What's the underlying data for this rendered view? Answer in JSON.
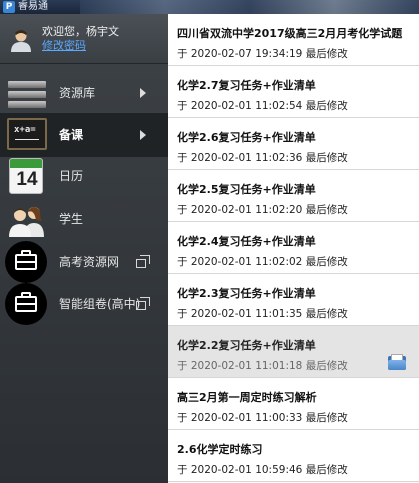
{
  "window": {
    "app_icon": "app-logo-icon",
    "title": "睿易通"
  },
  "user": {
    "avatar_icon": "user-avatar-icon",
    "welcome": "欢迎您，杨宇文",
    "change_password": "修改密码"
  },
  "nav": [
    {
      "label": "资源库",
      "icon": "bookshelf-icon",
      "has_arrow": true,
      "active": false
    },
    {
      "label": "备课",
      "icon": "blackboard-icon",
      "has_arrow": true,
      "active": true
    },
    {
      "label": "日历",
      "icon": "calendar-icon",
      "calendar_day": "14",
      "has_arrow": false,
      "active": false
    },
    {
      "label": "学生",
      "icon": "students-icon",
      "has_arrow": false,
      "active": false
    },
    {
      "label": "高考资源网",
      "icon": "briefcase-icon",
      "external_icon": "open-external-icon",
      "active": false
    },
    {
      "label": "智能组卷(高中)",
      "icon": "briefcase-icon",
      "external_icon": "open-external-icon",
      "active": false
    }
  ],
  "documents": [
    {
      "title": "四川省双流中学2017级高三2月月考化学试题",
      "meta": "于 2020-02-07 19:34:19 最后修改",
      "selected": false
    },
    {
      "title": "化学2.7复习任务+作业清单",
      "meta": "于 2020-02-01 11:02:54 最后修改",
      "selected": false
    },
    {
      "title": "化学2.6复习任务+作业清单",
      "meta": "于 2020-02-01 11:02:36 最后修改",
      "selected": false
    },
    {
      "title": "化学2.5复习任务+作业清单",
      "meta": "于 2020-02-01 11:02:20 最后修改",
      "selected": false
    },
    {
      "title": "化学2.4复习任务+作业清单",
      "meta": "于 2020-02-01 11:02:02 最后修改",
      "selected": false
    },
    {
      "title": "化学2.3复习任务+作业清单",
      "meta": "于 2020-02-01 11:01:35 最后修改",
      "selected": false
    },
    {
      "title": "化学2.2复习任务+作业清单",
      "meta": "于 2020-02-01 11:01:18 最后修改",
      "selected": true,
      "action_icon": "open-folder-icon"
    },
    {
      "title": "高三2月第一周定时练习解析",
      "meta": "于 2020-02-01 11:00:33 最后修改",
      "selected": false
    },
    {
      "title": "2.6化学定时练习",
      "meta": "于 2020-02-01 10:59:46 最后修改",
      "selected": false
    }
  ],
  "colors": {
    "sidebar_bg": "#2e3236",
    "active_nav_bg": "#1f2326",
    "link": "#5aa8ff",
    "selected_row_bg": "#e4e4e4"
  }
}
